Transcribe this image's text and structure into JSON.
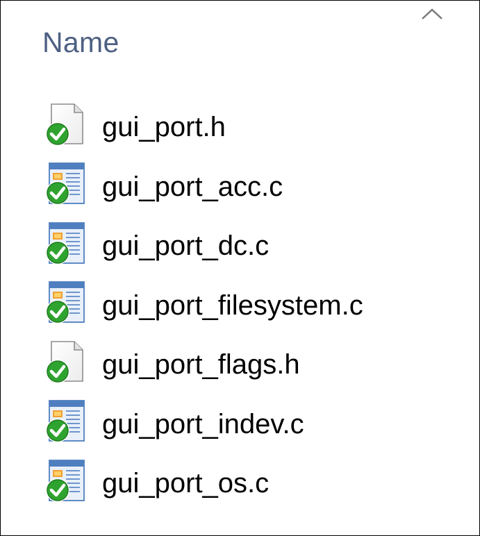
{
  "header": {
    "column_label": "Name",
    "sort_icon": "chevron-up-icon"
  },
  "files": [
    {
      "name": "gui_port.h",
      "kind": "header",
      "icon": "header-file-icon",
      "status_icon": "synced-check-icon"
    },
    {
      "name": "gui_port_acc.c",
      "kind": "source",
      "icon": "c-source-file-icon",
      "status_icon": "synced-check-icon"
    },
    {
      "name": "gui_port_dc.c",
      "kind": "source",
      "icon": "c-source-file-icon",
      "status_icon": "synced-check-icon"
    },
    {
      "name": "gui_port_filesystem.c",
      "kind": "source",
      "icon": "c-source-file-icon",
      "status_icon": "synced-check-icon"
    },
    {
      "name": "gui_port_flags.h",
      "kind": "header",
      "icon": "header-file-icon",
      "status_icon": "synced-check-icon"
    },
    {
      "name": "gui_port_indev.c",
      "kind": "source",
      "icon": "c-source-file-icon",
      "status_icon": "synced-check-icon"
    },
    {
      "name": "gui_port_os.c",
      "kind": "source",
      "icon": "c-source-file-icon",
      "status_icon": "synced-check-icon"
    }
  ],
  "colors": {
    "header_text": "#4d6082",
    "check_green": "#2fa32f",
    "source_icon_blue": "#4f7fbf"
  }
}
